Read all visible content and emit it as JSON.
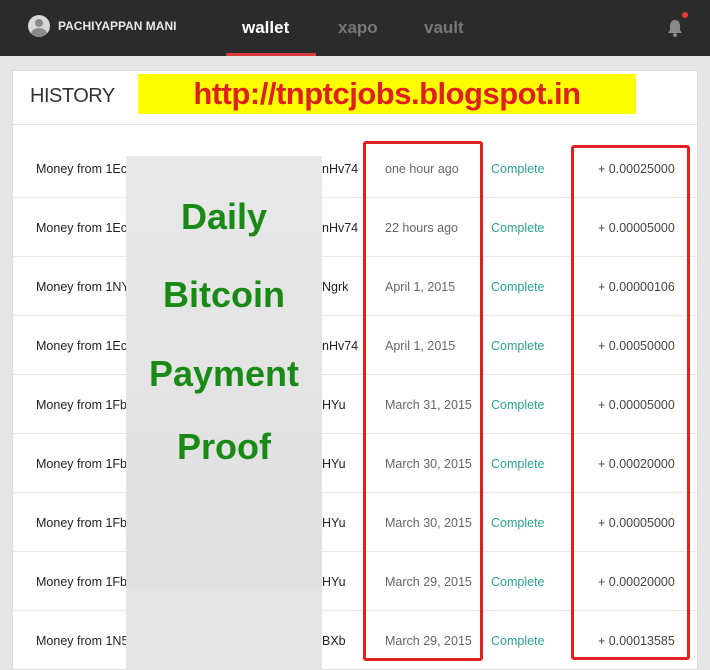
{
  "header": {
    "username": "PACHIYAPPAN MANI",
    "tabs": [
      {
        "label": "wallet"
      },
      {
        "label": "xapo"
      },
      {
        "label": "vault"
      }
    ]
  },
  "overlay": {
    "url": "http://tnptcjobs.blogspot.in",
    "proof_lines": [
      "Daily",
      "Bitcoin",
      "Payment",
      "Proof"
    ]
  },
  "history": {
    "title": "HISTORY",
    "rows": [
      {
        "from": "Money from 1Ec",
        "tail": "nHv74",
        "date": "one hour ago",
        "status": "Complete",
        "amount": "+ 0.00025000"
      },
      {
        "from": "Money from 1Ec",
        "tail": "nHv74",
        "date": "22 hours ago",
        "status": "Complete",
        "amount": "+ 0.00005000"
      },
      {
        "from": "Money from 1NY",
        "tail": "Ngrk",
        "date": "April 1, 2015",
        "status": "Complete",
        "amount": "+ 0.00000106"
      },
      {
        "from": "Money from 1Ec",
        "tail": "nHv74",
        "date": "April 1, 2015",
        "status": "Complete",
        "amount": "+ 0.00050000"
      },
      {
        "from": "Money from 1Fb",
        "tail": "HYu",
        "date": "March 31, 2015",
        "status": "Complete",
        "amount": "+ 0.00005000"
      },
      {
        "from": "Money from 1Fb",
        "tail": "HYu",
        "date": "March 30, 2015",
        "status": "Complete",
        "amount": "+ 0.00020000"
      },
      {
        "from": "Money from 1Fb",
        "tail": "HYu",
        "date": "March 30, 2015",
        "status": "Complete",
        "amount": "+ 0.00005000"
      },
      {
        "from": "Money from 1Fb",
        "tail": "HYu",
        "date": "March 29, 2015",
        "status": "Complete",
        "amount": "+ 0.00020000"
      },
      {
        "from": "Money from 1N5",
        "tail": "BXb",
        "date": "March 29, 2015",
        "status": "Complete",
        "amount": "+ 0.00013585"
      }
    ]
  },
  "colors": {
    "topbar": "#2b2b2b",
    "tab_active_underline": "#d9383e",
    "status_complete": "#2aa58f",
    "highlight_box": "#e32020",
    "banner_bg": "#ffff00",
    "banner_text": "#e02020",
    "proof_text": "#1a8a16"
  },
  "icons": {
    "avatar": "user-avatar-icon",
    "notifications": "bell-icon"
  }
}
